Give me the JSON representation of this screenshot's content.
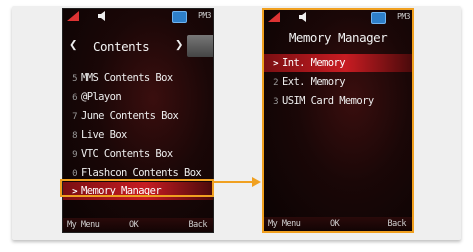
{
  "left_screen": {
    "status": {
      "time": "PM3"
    },
    "title": "Contents",
    "items": [
      {
        "num": "5",
        "label": "MMS Contents Box"
      },
      {
        "num": "6",
        "label": "@Playon"
      },
      {
        "num": "7",
        "label": "June Contents Box"
      },
      {
        "num": "8",
        "label": "Live Box"
      },
      {
        "num": "9",
        "label": "VTC Contents Box"
      },
      {
        "num": "0",
        "label": "Flashcon Contents Box"
      },
      {
        "num": ">",
        "label": "Memory Manager"
      }
    ],
    "softkeys": {
      "left": "My Menu",
      "center": "OK",
      "right": "Back"
    }
  },
  "right_screen": {
    "status": {
      "time": "PM3"
    },
    "title": "Memory Manager",
    "items": [
      {
        "num": ">",
        "label": "Int. Memory"
      },
      {
        "num": "2",
        "label": "Ext. Memory"
      },
      {
        "num": "3",
        "label": "USIM Card Memory"
      }
    ],
    "softkeys": {
      "left": "My Menu",
      "center": "OK",
      "right": "Back"
    }
  },
  "colors": {
    "highlight": "#f0a020",
    "selection": "#c81c22"
  },
  "icons": [
    "signal-icon",
    "speaker-icon",
    "battery-icon",
    "left-arrow-icon",
    "right-arrow-icon"
  ]
}
